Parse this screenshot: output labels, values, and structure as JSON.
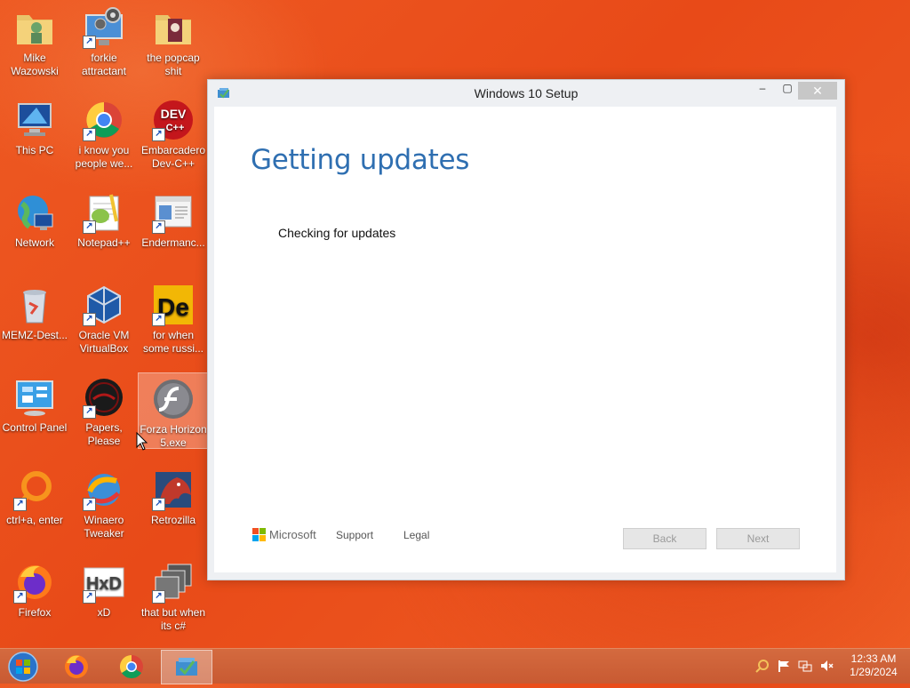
{
  "desktop": {
    "icons": [
      {
        "label": "Mike Wazowski"
      },
      {
        "label": "forkie attractant"
      },
      {
        "label": "the popcap shit"
      },
      {
        "label": "This PC"
      },
      {
        "label": "i know you people we..."
      },
      {
        "label": "Embarcadero Dev-C++"
      },
      {
        "label": "Network"
      },
      {
        "label": "Notepad++"
      },
      {
        "label": "Endermanc..."
      },
      {
        "label": "MEMZ-Dest..."
      },
      {
        "label": "Oracle VM VirtualBox"
      },
      {
        "label": "for when some russi..."
      },
      {
        "label": "Control Panel"
      },
      {
        "label": "Papers, Please"
      },
      {
        "label": "Forza Horizon 5.exe"
      },
      {
        "label": "ctrl+a, enter"
      },
      {
        "label": "Winaero Tweaker"
      },
      {
        "label": "Retrozilla"
      },
      {
        "label": "Firefox"
      },
      {
        "label": "xD"
      },
      {
        "label": "that but when its c#"
      }
    ],
    "dev_icon_text": "DEV",
    "dev_icon_sub": "C++",
    "de_icon_text": "De",
    "hxd_icon_text": "HxD"
  },
  "setup_window": {
    "title": "Windows 10 Setup",
    "min_glyph": "‒",
    "max_glyph": "▢",
    "close_glyph": "✕",
    "heading": "Getting updates",
    "status": "Checking for updates",
    "brand": "Microsoft",
    "support_link": "Support",
    "legal_link": "Legal",
    "back_button": "Back",
    "next_button": "Next",
    "ms_colors": [
      "#f25022",
      "#7fba00",
      "#00a4ef",
      "#ffb900"
    ]
  },
  "taskbar": {
    "time": "12:33 AM",
    "date": "1/29/2024"
  },
  "colors": {
    "heading_blue": "#2f6fb1",
    "desktop_orange": "#ee5a23"
  }
}
